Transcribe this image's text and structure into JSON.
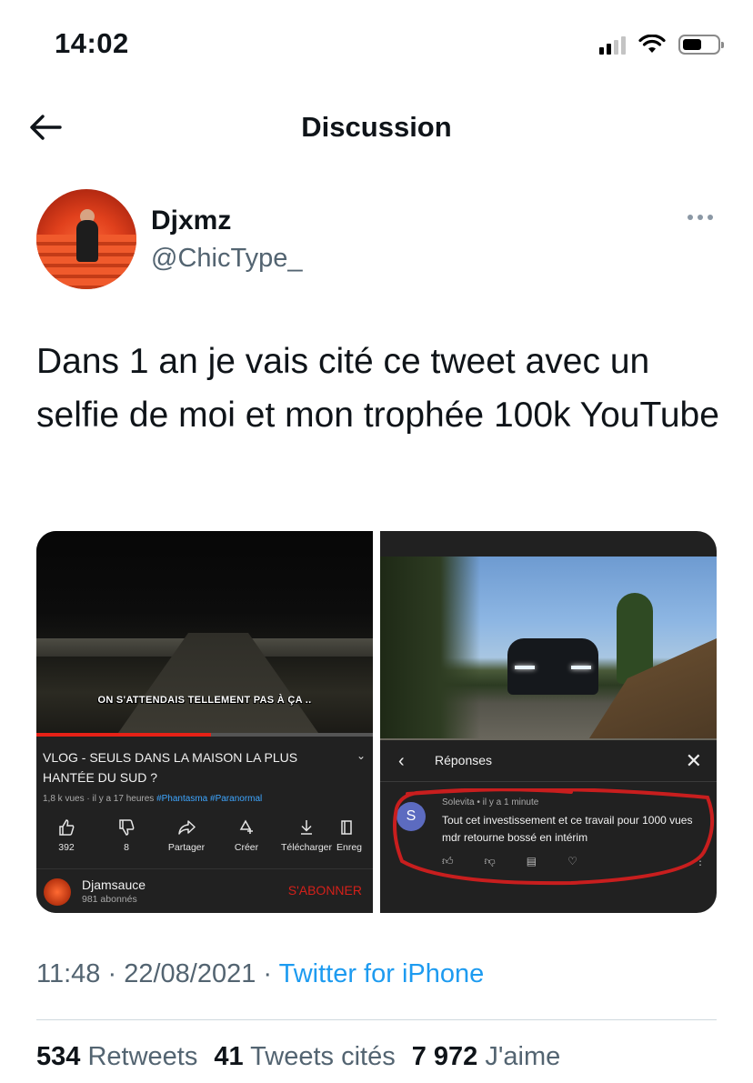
{
  "status_bar": {
    "time": "14:02"
  },
  "header": {
    "title": "Discussion"
  },
  "author": {
    "name": "Djxmz",
    "handle": "@ChicType_"
  },
  "tweet": {
    "text": "Dans 1 an je vais cité ce tweet avec un selfie de moi et mon trophée 100k YouTube",
    "timestamp": "11:48 · 22/08/2021 · ",
    "source": "Twitter for iPhone"
  },
  "media_left": {
    "overlay_caption": "ON S'ATTENDAIS TELLEMENT PAS À ÇA ..",
    "progress": 0.52,
    "video_title": "VLOG - SEULS DANS LA MAISON LA PLUS HANTÉE DU SUD ?",
    "meta_prefix": "1,8 k vues · il y a 17 heures ",
    "tags": [
      "#Phantasma",
      "#Paranormal"
    ],
    "actions": [
      {
        "icon": "thumbs-up-icon",
        "label": "392"
      },
      {
        "icon": "thumbs-down-icon",
        "label": "8"
      },
      {
        "icon": "share-icon",
        "label": "Partager"
      },
      {
        "icon": "create-icon",
        "label": "Créer"
      },
      {
        "icon": "download-icon",
        "label": "Télécharger"
      },
      {
        "icon": "save-icon",
        "label": "Enreg"
      }
    ],
    "channel_name": "Djamsauce",
    "channel_subs": "981 abonnés",
    "subscribe_label": "S'ABONNER"
  },
  "media_right": {
    "replies_title": "Réponses",
    "comment": {
      "avatar_letter": "S",
      "author_line": "Solevita • il y a 1 minute",
      "text": "Tout cet investissement et ce travail pour 1000 vues mdr retourne bossé en intérim"
    }
  },
  "stats": [
    {
      "count": "534",
      "label": "Retweets"
    },
    {
      "count": "41",
      "label": "Tweets cités"
    },
    {
      "count": "7 972",
      "label": "J'aime"
    }
  ],
  "colors": {
    "link": "#1d9bf0",
    "secondary_text": "#536471",
    "yt_red": "#e62117",
    "annotation": "#c81e1e"
  }
}
